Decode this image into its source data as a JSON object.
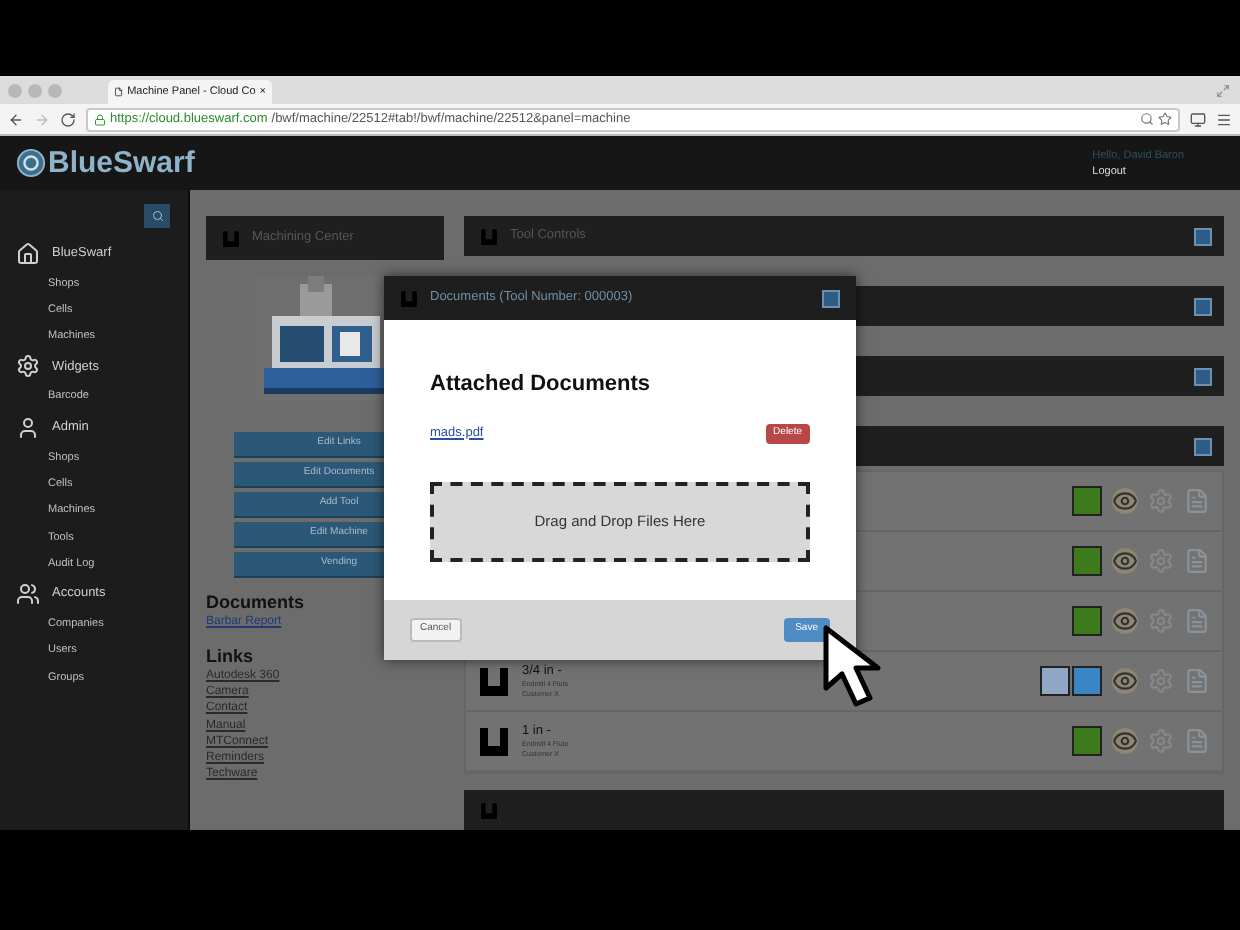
{
  "browser": {
    "tab_title": "Machine Panel - Cloud Co",
    "tab_close": "×",
    "url_host": "https://cloud.blueswarf.com",
    "url_path": "/bwf/machine/22512#tab!/bwf/machine/22512&panel=machine"
  },
  "header": {
    "logo": "BlueSwarf",
    "greeting": "Hello, David Baron",
    "logout": "Logout"
  },
  "sidebar": {
    "sections": [
      {
        "label": "BlueSwarf",
        "kind": "home",
        "items": [
          "Shops",
          "Cells",
          "Machines"
        ]
      },
      {
        "label": "Widgets",
        "kind": "gear",
        "items": [
          "Barcode"
        ]
      },
      {
        "label": "Admin",
        "kind": "user",
        "items": [
          "Shops",
          "Cells",
          "Machines",
          "Tools",
          "Audit Log"
        ]
      },
      {
        "label": "Accounts",
        "kind": "users",
        "items": [
          "Companies",
          "Users",
          "Groups"
        ]
      }
    ]
  },
  "machine_panel": {
    "title": "Machining Center",
    "picture": {
      "kind": "picture"
    },
    "buttons": [
      "Edit Links",
      "Edit Documents",
      "Add Tool",
      "Edit Machine",
      "Vending"
    ],
    "documents_heading": "Documents",
    "documents": [
      "Barbar Report"
    ],
    "links_heading": "Links",
    "links": [
      "Autodesk 360",
      "Camera",
      "Contact",
      "Manual",
      "MTConnect",
      "Reminders",
      "Techware"
    ]
  },
  "tool_controls": {
    "title": "Tool Controls"
  },
  "tools": [
    {
      "swatches": [
        {
          "color": "#3d7a1c"
        }
      ]
    },
    {
      "swatches": [
        {
          "color": "#3d7a1c"
        }
      ]
    },
    {
      "swatches": [
        {
          "color": "#3d7a1c"
        }
      ]
    },
    {
      "name": "3/4 in -",
      "detail_1": "Endmill 4 Flute",
      "detail_2": "Customer X",
      "swatches": [
        {
          "color": "#8fa6c4"
        },
        {
          "color": "#3a86c4"
        }
      ]
    },
    {
      "name": "1 in -",
      "detail_1": "Endmill 4 Flute",
      "detail_2": "Customer X",
      "swatches": [
        {
          "color": "#3d7a1c"
        }
      ]
    }
  ],
  "modal": {
    "title": "Documents (Tool Number: 000003)",
    "heading": "Attached Documents",
    "files": [
      {
        "name": "mads.pdf",
        "action": "Delete"
      }
    ],
    "dropzone": "Drag and Drop Files Here",
    "cancel": "Cancel",
    "save": "Save"
  }
}
